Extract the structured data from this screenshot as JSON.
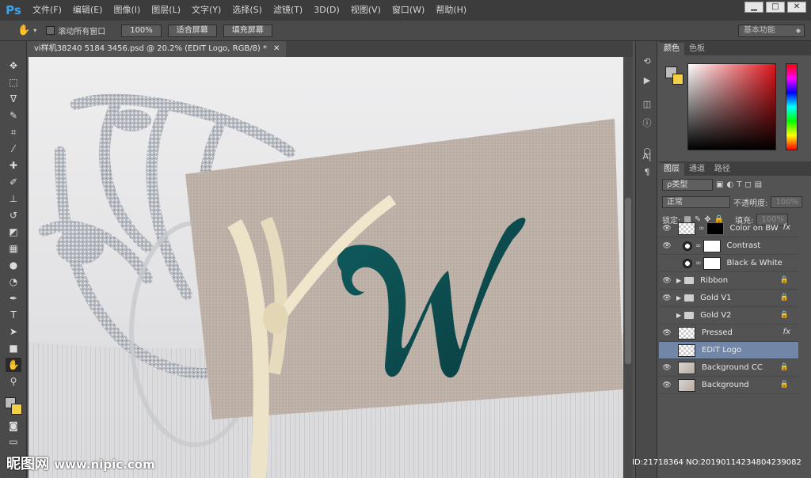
{
  "app": {
    "logo": "Ps"
  },
  "menu": [
    "文件(F)",
    "编辑(E)",
    "图像(I)",
    "图层(L)",
    "文字(Y)",
    "选择(S)",
    "滤镜(T)",
    "3D(D)",
    "视图(V)",
    "窗口(W)",
    "帮助(H)"
  ],
  "window_controls": {
    "minimize": "▁",
    "maximize": "□",
    "close": "✕"
  },
  "options": {
    "tool_icon": "hand-icon",
    "scroll_all_label": "滚动所有窗口",
    "zoom100": "100%",
    "fit_screen": "适合屏幕",
    "fill_screen": "填充屏幕",
    "workspace": "基本功能"
  },
  "document": {
    "tab_title": "vi样机38240 5184 3456.psd @ 20.2% (EDIT Logo, RGB/8) *",
    "close": "✕"
  },
  "color_panel": {
    "tabs": [
      "颜色",
      "色板"
    ],
    "fg_color": "#bcbcbc",
    "bg_color": "#f2cf44"
  },
  "layers_panel": {
    "tabs": [
      "图层",
      "通道",
      "路径"
    ],
    "filter_label": "ρ类型",
    "blend_mode": "正常",
    "opacity_label": "不透明度:",
    "opacity_value": "100%",
    "lock_label": "锁定:",
    "fill_label": "填充:",
    "fill_value": "100%",
    "layers": [
      {
        "name": "Color on BW",
        "visible": true,
        "fx": "fx"
      },
      {
        "name": "Contrast",
        "visible": true
      },
      {
        "name": "Black & White",
        "visible": false
      },
      {
        "name": "Ribbon",
        "visible": true,
        "type": "group",
        "locked": true
      },
      {
        "name": "Gold V1",
        "visible": true,
        "type": "group",
        "locked": true
      },
      {
        "name": "Gold V2",
        "visible": false,
        "type": "group",
        "locked": true
      },
      {
        "name": "Pressed",
        "visible": true,
        "fx": "fx"
      },
      {
        "name": "EDIT Logo",
        "visible": false,
        "selected": true
      },
      {
        "name": "Background CC",
        "visible": true,
        "locked": true
      },
      {
        "name": "Background",
        "visible": true,
        "locked": true
      }
    ]
  },
  "watermark": {
    "site": "昵图网",
    "url": "www.nipic.com",
    "id_text": "ID:21718364 NO:20190114234804239082"
  }
}
